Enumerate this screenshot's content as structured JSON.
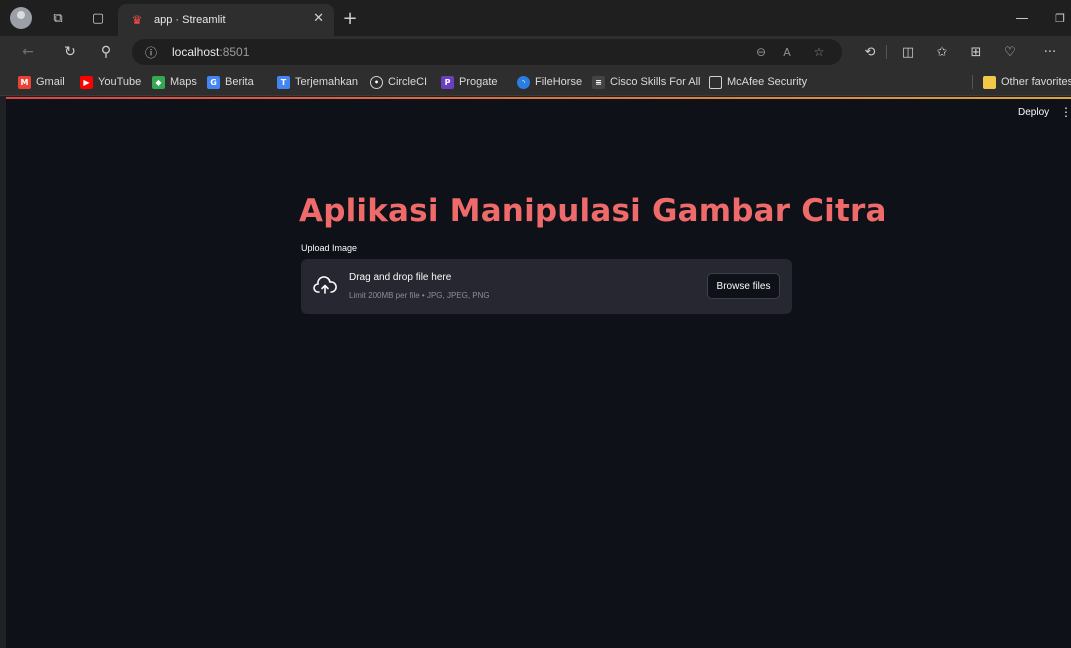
{
  "browser": {
    "tab": {
      "title": "app · Streamlit",
      "favicon": "streamlit-crown-icon"
    },
    "address": {
      "host": "localhost",
      "port": ":8501"
    },
    "bookmarks": [
      {
        "label": "Gmail",
        "icon": "gmail-icon",
        "color": "#ea4335"
      },
      {
        "label": "YouTube",
        "icon": "youtube-icon",
        "color": "#ff0000"
      },
      {
        "label": "Maps",
        "icon": "maps-icon",
        "color": "#34a853"
      },
      {
        "label": "Berita",
        "icon": "news-icon",
        "color": "#4285f4"
      },
      {
        "label": "Terjemahkan",
        "icon": "translate-icon",
        "color": "#4285f4"
      },
      {
        "label": "CircleCI",
        "icon": "circleci-icon",
        "color": "#d0d0d0"
      },
      {
        "label": "Progate",
        "icon": "progate-icon",
        "color": "#6c3ec1"
      },
      {
        "label": "FileHorse",
        "icon": "filehorse-icon",
        "color": "#2a7de1"
      },
      {
        "label": "Cisco Skills For All",
        "icon": "cisco-icon",
        "color": "#444444"
      },
      {
        "label": "McAfee Security",
        "icon": "document-icon",
        "color": "#d0d0d0"
      }
    ],
    "other_favorites": "Other favorites"
  },
  "app": {
    "deploy_label": "Deploy",
    "title": "Aplikasi Manipulasi Gambar Citra",
    "upload_label": "Upload Image",
    "drop_title": "Drag and drop file here",
    "drop_limit": "Limit 200MB per file • JPG, JPEG, PNG",
    "browse_label": "Browse files",
    "accent_color": "#ef6a6a"
  }
}
